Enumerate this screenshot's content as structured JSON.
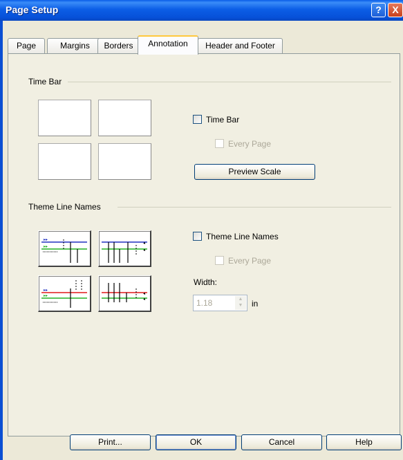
{
  "window": {
    "title": "Page Setup",
    "help_glyph": "?",
    "close_glyph": "X"
  },
  "tabs": [
    {
      "label": "Page"
    },
    {
      "label": "Margins"
    },
    {
      "label": "Borders"
    },
    {
      "label": "Annotation",
      "active": true
    },
    {
      "label": "Header and Footer"
    }
  ],
  "time_bar": {
    "group_title": "Time Bar",
    "checkbox_label": "Time Bar",
    "every_page_label": "Every Page",
    "preview_button": "Preview Scale"
  },
  "theme_line_names": {
    "group_title": "Theme Line Names",
    "checkbox_label": "Theme Line Names",
    "every_page_label": "Every Page",
    "width_label": "Width:",
    "width_value": "1.18",
    "width_unit": "in"
  },
  "buttons": {
    "print": "Print...",
    "ok": "OK",
    "cancel": "Cancel",
    "help": "Help"
  },
  "colors": {
    "title_bar": "#0a5de8",
    "dialog_bg": "#ece9d8",
    "panel_bg": "#f1efe2",
    "active_tab_accent": "#ffc83c",
    "line_blue": "#2030c0",
    "line_green": "#20b020",
    "line_red": "#e01818"
  }
}
